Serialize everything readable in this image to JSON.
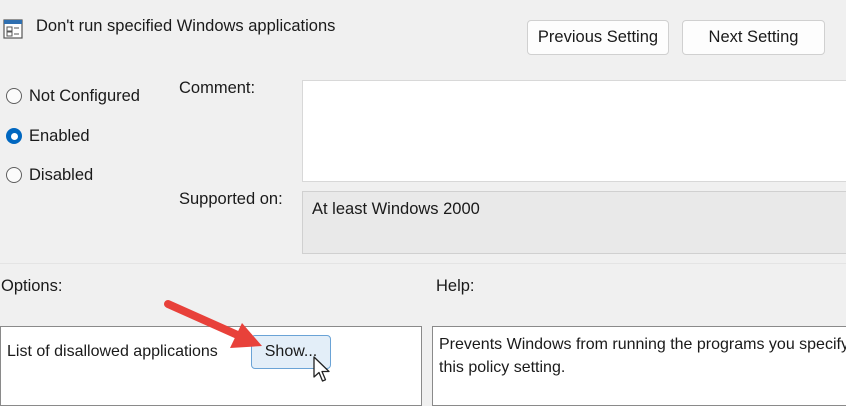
{
  "window": {
    "title": "Don't run specified Windows applications",
    "title_icon": "policy-setting-icon"
  },
  "header": {
    "previous_label": "Previous Setting",
    "next_label": "Next Setting"
  },
  "state": {
    "options": [
      {
        "label": "Not Configured",
        "checked": false
      },
      {
        "label": "Enabled",
        "checked": true
      },
      {
        "label": "Disabled",
        "checked": false
      }
    ]
  },
  "comment": {
    "label": "Comment:",
    "value": ""
  },
  "supported": {
    "label": "Supported on:",
    "value": "At least Windows 2000"
  },
  "options_section": {
    "label": "Options:",
    "list_label": "List of disallowed applications",
    "show_label": "Show..."
  },
  "help_section": {
    "label": "Help:",
    "text": "Prevents Windows from running the programs you specify in this policy setting."
  },
  "colors": {
    "accent": "#0067c0",
    "annotation_arrow": "#e8413a",
    "window_bg": "#f0f0f0"
  },
  "annotation": {
    "arrow": "red-arrow-icon",
    "cursor": "mouse-pointer-icon"
  }
}
